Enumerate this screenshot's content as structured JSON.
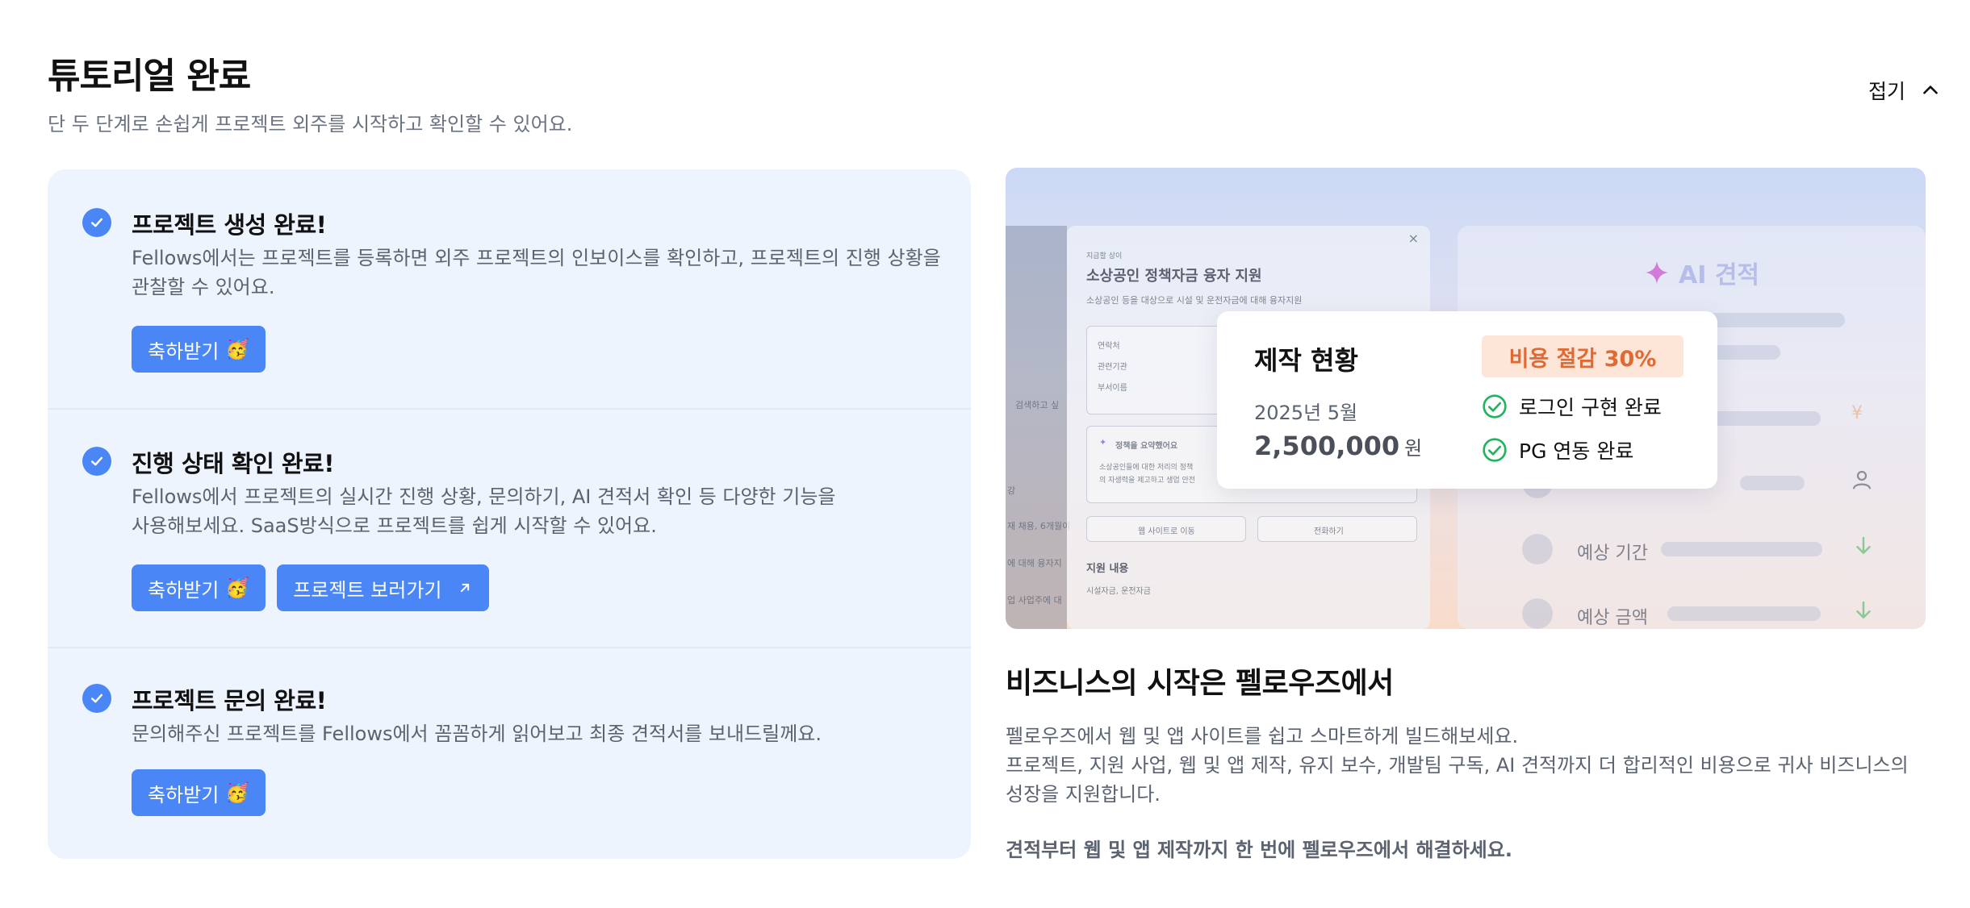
{
  "header": {
    "title": "튜토리얼 완료",
    "subtitle": "단 두 단계로 손쉽게 프로젝트 외주를 시작하고 확인할 수 있어요.",
    "collapse_label": "접기"
  },
  "steps": [
    {
      "title": "프로젝트 생성 완료!",
      "desc": "Fellows에서는 프로젝트를 등록하면 외주 프로젝트의 인보이스를 확인하고, 프로젝트의 진행 상황을 관찰할 수 있어요.",
      "buttons": [
        {
          "label": "축하받기",
          "emoji": "🥳"
        }
      ]
    },
    {
      "title": "진행 상태 확인 완료!",
      "desc_line1": "Fellows에서 프로젝트의 실시간 진행 상황, 문의하기, AI 견적서 확인 등 다양한 기능을",
      "desc_line2": "사용해보세요. SaaS방식으로 프로젝트를 쉽게 시작할 수 있어요.",
      "buttons": [
        {
          "label": "축하받기",
          "emoji": "🥳"
        },
        {
          "label": "프로젝트 보러가기"
        }
      ]
    },
    {
      "title": "프로젝트 문의 완료!",
      "desc": "문의해주신 프로젝트를 Fellows에서 꼼꼼하게 읽어보고 최종 견적서를 보내드릴께요.",
      "buttons": [
        {
          "label": "축하받기",
          "emoji": "🥳"
        }
      ]
    }
  ],
  "preview": {
    "bg_card": {
      "tag": "지금할 상이",
      "title": "소상공인 정책자금 융자 지원",
      "subtitle": "소상공인 등을 대상으로 시설 및 운전자금에 대해 융자지원",
      "fields": [
        "연락처",
        "관련기관",
        "부서이름"
      ],
      "summary_title": "정책을 요약했어요",
      "summary_line1": "소상공인들에 대한 저리의 정책",
      "summary_line2": "의 자생력을 제고하고 생업 안전",
      "btn_site": "웹 사이트로 이동",
      "btn_call": "전화하기",
      "support_title": "지원 내용",
      "support_item": "시설자금, 운전자금",
      "side_frag1": "검색하고 싶",
      "side_frag2": "강",
      "side_frag3": "재 채용, 6개월이",
      "side_frag4": "에 대해 융자지",
      "side_frag5": "업 사업주에 대"
    },
    "ai_card": {
      "title": "AI 견적",
      "row_period": "예상 기간",
      "row_cost": "예상 금액"
    },
    "status_card": {
      "title": "제작 현황",
      "date": "2025년 5월",
      "amount": "2,500,000",
      "unit": "원",
      "badge": "비용 절감 30%",
      "check1": "로그인 구현 완료",
      "check2": "PG 연동 완료"
    }
  },
  "promo": {
    "title": "비즈니스의 시작은 펠로우즈에서",
    "line1": "펠로우즈에서 웹 및 앱 사이트를 쉽고 스마트하게 빌드해보세요.",
    "line2": "프로젝트, 지원 사업, 웹 및 앱 제작, 유지 보수, 개발팀 구독, AI 견적까지 더 합리적인 비용으로 귀사 비즈니스의",
    "line3": "성장을 지원합니다.",
    "footer": "견적부터 웹 및 앱 제작까지 한 번에 펠로우즈에서 해결하세요."
  },
  "colors": {
    "primary": "#4a86f5",
    "panel_bg": "#eef4fe",
    "badge_text": "#e06a34",
    "badge_bg": "#fde6d8",
    "check_green": "#22b35e"
  }
}
